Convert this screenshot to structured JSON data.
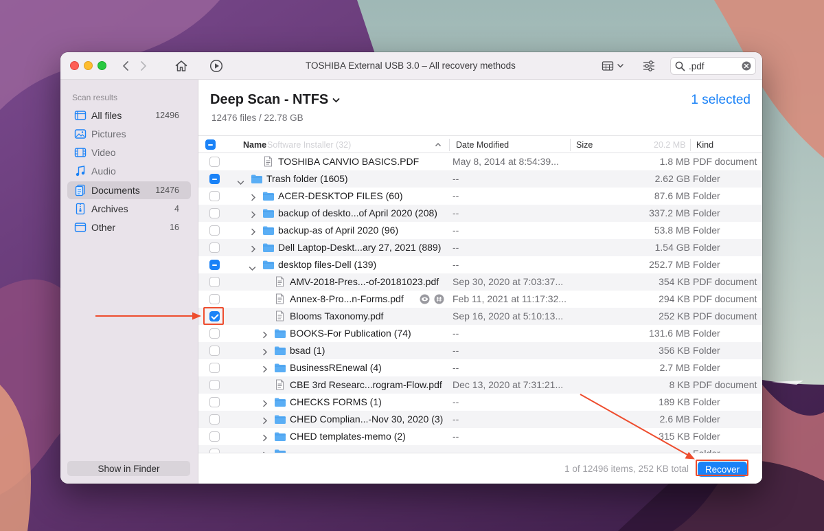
{
  "window": {
    "title": "TOSHIBA External USB 3.0 – All recovery methods"
  },
  "search": {
    "value": ".pdf"
  },
  "icons": {
    "back": "chevron-left-icon",
    "forward": "chevron-right-icon",
    "home": "home-icon",
    "play": "play-circle-icon",
    "view": "grid-view-icon",
    "filters": "sliders-icon",
    "search": "search-icon",
    "clear": "clear-icon"
  },
  "colors": {
    "accent": "#1a82f7",
    "annotation": "#ee4d2e",
    "folder": "#5aaef5"
  },
  "sidebar": {
    "heading": "Scan results",
    "items": [
      {
        "label": "All files",
        "count": "12496",
        "icon": "all-files-icon"
      },
      {
        "label": "Pictures",
        "count": "",
        "icon": "pictures-icon"
      },
      {
        "label": "Video",
        "count": "",
        "icon": "video-icon"
      },
      {
        "label": "Audio",
        "count": "",
        "icon": "audio-icon"
      },
      {
        "label": "Documents",
        "count": "12476",
        "icon": "documents-icon",
        "active": true
      },
      {
        "label": "Archives",
        "count": "4",
        "icon": "archives-icon"
      },
      {
        "label": "Other",
        "count": "16",
        "icon": "other-icon"
      }
    ],
    "show_in_finder": "Show in Finder"
  },
  "main": {
    "scan_title": "Deep Scan - NTFS",
    "subtitle": "12476 files / 22.78 GB",
    "selected": "1 selected"
  },
  "columns": {
    "name": "Name",
    "ghost_text": "Software Installer (32)",
    "ghost_size": "20.2 MB",
    "date": "Date Modified",
    "size": "Size",
    "kind": "Kind"
  },
  "rows": [
    {
      "name": "TOSHIBA CANVIO BASICS.PDF",
      "date": "May 8, 2014 at 8:54:39...",
      "size": "1.8 MB",
      "kind": "PDF document",
      "type": "file",
      "indent": 1,
      "check": "none"
    },
    {
      "name": "Trash folder (1605)",
      "date": "--",
      "size": "2.62 GB",
      "kind": "Folder",
      "type": "folder",
      "indent": 0,
      "check": "mixed",
      "expanded": true
    },
    {
      "name": "ACER-DESKTOP FILES (60)",
      "date": "--",
      "size": "87.6 MB",
      "kind": "Folder",
      "type": "folder",
      "indent": 1,
      "check": "none"
    },
    {
      "name": "backup of deskto...of April 2020 (208)",
      "date": "--",
      "size": "337.2 MB",
      "kind": "Folder",
      "type": "folder",
      "indent": 1,
      "check": "none"
    },
    {
      "name": "backup-as of April 2020 (96)",
      "date": "--",
      "size": "53.8 MB",
      "kind": "Folder",
      "type": "folder",
      "indent": 1,
      "check": "none"
    },
    {
      "name": "Dell Laptop-Deskt...ary 27, 2021 (889)",
      "date": "--",
      "size": "1.54 GB",
      "kind": "Folder",
      "type": "folder",
      "indent": 1,
      "check": "none"
    },
    {
      "name": "desktop files-Dell (139)",
      "date": "--",
      "size": "252.7 MB",
      "kind": "Folder",
      "type": "folder",
      "indent": 1,
      "check": "mixed",
      "expanded": true
    },
    {
      "name": "AMV-2018-Pres...-of-20181023.pdf",
      "date": "Sep 30, 2020 at 7:03:37...",
      "size": "354 KB",
      "kind": "PDF document",
      "type": "file",
      "indent": 2,
      "check": "none"
    },
    {
      "name": "Annex-8-Pro...n-Forms.pdf",
      "date": "Feb 11, 2021 at 11:17:32...",
      "size": "294 KB",
      "kind": "PDF document",
      "type": "file",
      "indent": 2,
      "check": "none",
      "extra": true
    },
    {
      "name": "Blooms Taxonomy.pdf",
      "date": "Sep 16, 2020 at 5:10:13...",
      "size": "252 KB",
      "kind": "PDF document",
      "type": "file",
      "indent": 2,
      "check": "checked"
    },
    {
      "name": "BOOKS-For Publication (74)",
      "date": "--",
      "size": "131.6 MB",
      "kind": "Folder",
      "type": "folder",
      "indent": 2,
      "check": "none"
    },
    {
      "name": "bsad (1)",
      "date": "--",
      "size": "356 KB",
      "kind": "Folder",
      "type": "folder",
      "indent": 2,
      "check": "none"
    },
    {
      "name": "BusinessREnewal (4)",
      "date": "--",
      "size": "2.7 MB",
      "kind": "Folder",
      "type": "folder",
      "indent": 2,
      "check": "none"
    },
    {
      "name": "CBE 3rd Researc...rogram-Flow.pdf",
      "date": "Dec 13, 2020 at 7:31:21...",
      "size": "8 KB",
      "kind": "PDF document",
      "type": "file",
      "indent": 2,
      "check": "none"
    },
    {
      "name": "CHECKS FORMS (1)",
      "date": "--",
      "size": "189 KB",
      "kind": "Folder",
      "type": "folder",
      "indent": 2,
      "check": "none"
    },
    {
      "name": "CHED Complian...-Nov 30, 2020 (3)",
      "date": "--",
      "size": "2.6 MB",
      "kind": "Folder",
      "type": "folder",
      "indent": 2,
      "check": "none"
    },
    {
      "name": "CHED templates-memo (2)",
      "date": "--",
      "size": "315 KB",
      "kind": "Folder",
      "type": "folder",
      "indent": 2,
      "check": "none"
    },
    {
      "name": "",
      "date": "--",
      "size": "",
      "kind": "Folder",
      "type": "folder",
      "indent": 2,
      "check": "none",
      "partial": true
    }
  ],
  "footer": {
    "status": "1 of 12496 items, 252 KB total",
    "recover": "Recover"
  }
}
